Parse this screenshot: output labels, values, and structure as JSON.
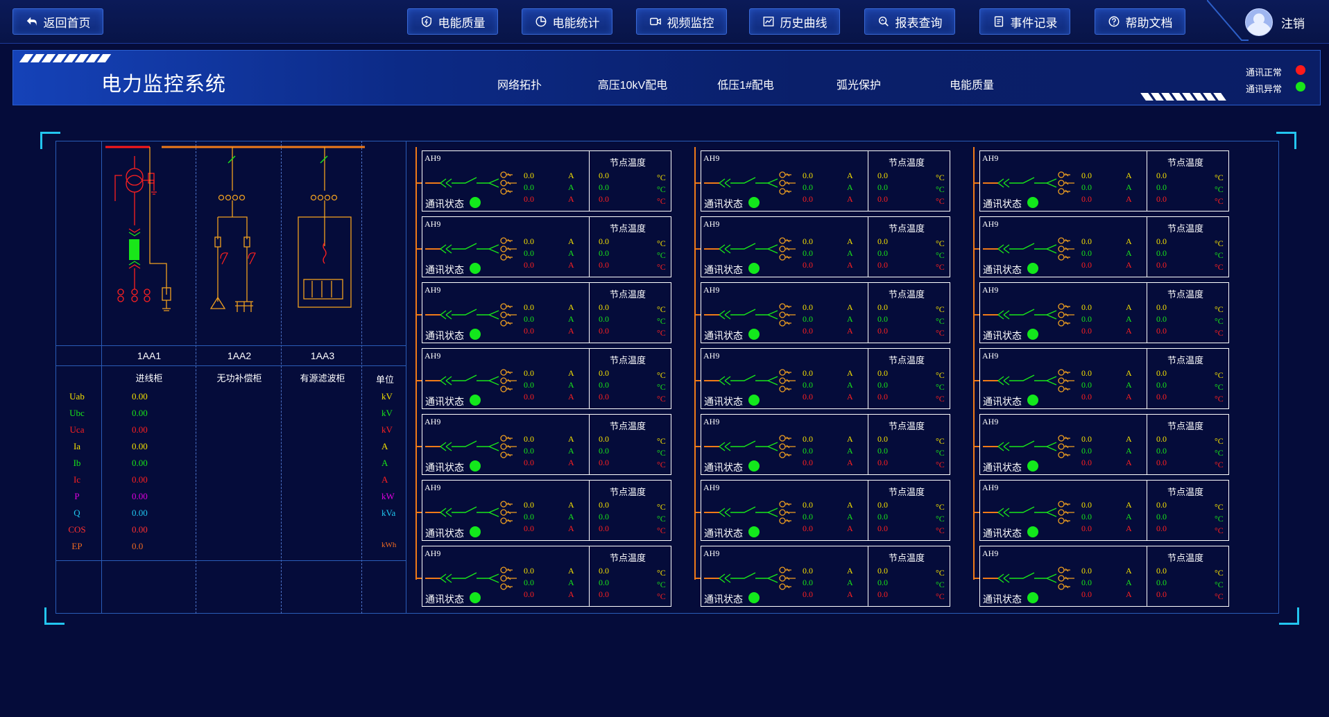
{
  "nav": {
    "back": "返回首页",
    "items": [
      "电能质量",
      "电能统计",
      "视频监控",
      "历史曲线",
      "报表查询",
      "事件记录",
      "帮助文档"
    ],
    "user": "注销"
  },
  "header": {
    "title": "电力监控系统",
    "tabs": [
      "网络拓扑",
      "高压10kV配电",
      "低压1#配电",
      "弧光保护",
      "电能质量"
    ],
    "status_normal": "通讯正常",
    "status_abnormal": "通讯异常",
    "colors": {
      "normal": "#ff1a1a",
      "abnormal": "#19e619"
    }
  },
  "panel": {
    "codes": [
      "1AA1",
      "1AA2",
      "1AA3"
    ],
    "names": [
      "进线柜",
      "无功补偿柜",
      "有源滤波柜"
    ],
    "unit_header": "单位",
    "rows": [
      {
        "name": "Uab",
        "value": "0.00",
        "unit": "kV",
        "color": "#f5e100"
      },
      {
        "name": "Ubc",
        "value": "0.00",
        "unit": "kV",
        "color": "#19e619"
      },
      {
        "name": "Uca",
        "value": "0.00",
        "unit": "kV",
        "color": "#ff2020"
      },
      {
        "name": "Ia",
        "value": "0.00",
        "unit": "A",
        "color": "#f5e100"
      },
      {
        "name": "Ib",
        "value": "0.00",
        "unit": "A",
        "color": "#19e619"
      },
      {
        "name": "Ic",
        "value": "0.00",
        "unit": "A",
        "color": "#ff2020"
      },
      {
        "name": "P",
        "value": "0.00",
        "unit": "kW",
        "color": "#e000e0"
      },
      {
        "name": "Q",
        "value": "0.00",
        "unit": "kVa",
        "color": "#20c8f0"
      },
      {
        "name": "COS",
        "value": "0.00",
        "unit": "",
        "color": "#ff3030"
      },
      {
        "name": "EP",
        "value": "0.0",
        "unit": "kWh",
        "color": "#f06a20"
      }
    ]
  },
  "feeder": {
    "name": "AH9",
    "temp_title": "节点温度",
    "comm_label": "通讯状态",
    "current": [
      "0.0",
      "0.0",
      "0.0"
    ],
    "current_unit": "A",
    "temp": [
      "0.0",
      "0.0",
      "0.0"
    ],
    "temp_unit": "°C",
    "phase_colors": [
      "#f5e100",
      "#19e619",
      "#ff2020"
    ],
    "comm_color": "#13e81c"
  }
}
